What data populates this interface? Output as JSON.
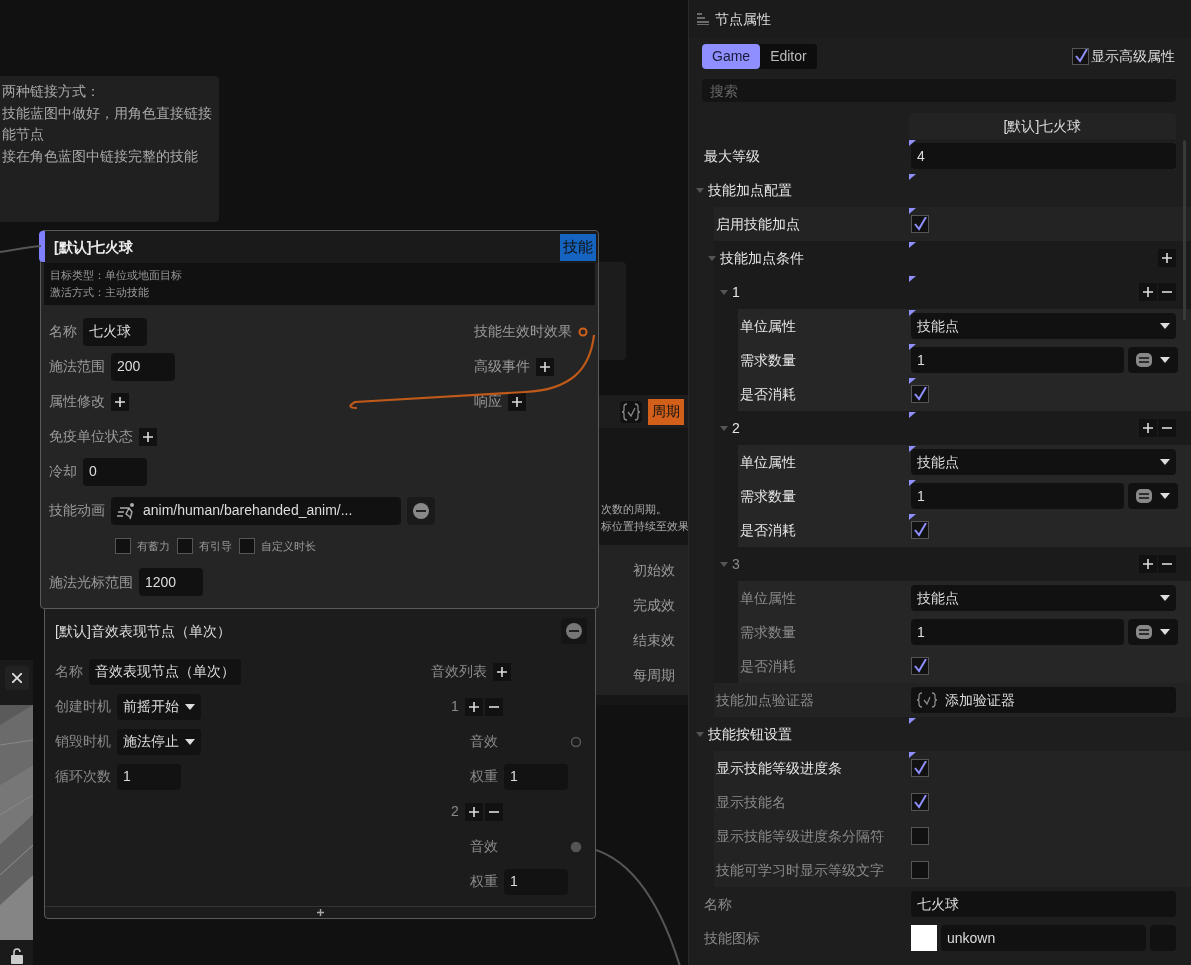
{
  "canvas": {
    "comment": {
      "lines": [
        "两种链接方式：",
        "技能蓝图中做好，用角色直接链接",
        "能节点",
        "接在角色蓝图中链接完整的技能"
      ]
    },
    "back_node": {
      "badge": "周期",
      "description": [
        "次数的周期。",
        "标位置持续至效果"
      ],
      "outputs": [
        "初始效",
        "完成效",
        "结束效",
        "每周期"
      ]
    },
    "skill_node": {
      "title": "[默认]七火球",
      "badge": "技能",
      "info": [
        "目标类型：单位或地面目标",
        "激活方式：主动技能"
      ],
      "rows": [
        {
          "kind": "field",
          "label": "名称",
          "value": "七火球"
        },
        {
          "kind": "field",
          "label": "施法范围",
          "value": "200"
        },
        {
          "kind": "add",
          "label": "属性修改"
        },
        {
          "kind": "add",
          "label": "免疫单位状态"
        },
        {
          "kind": "field",
          "label": "冷却",
          "value": "0"
        },
        {
          "kind": "asset",
          "label": "技能动画",
          "value": "anim/human/barehanded_anim/..."
        },
        {
          "kind": "flags",
          "items": [
            {
              "label": "有蓄力",
              "checked": false
            },
            {
              "label": "有引导",
              "checked": false
            },
            {
              "label": "自定义时长",
              "checked": false
            }
          ]
        },
        {
          "kind": "field",
          "label": "施法光标范围",
          "value": "1200"
        }
      ],
      "outputs": [
        {
          "kind": "port",
          "label": "技能生效时效果"
        },
        {
          "kind": "add",
          "label": "高级事件"
        },
        {
          "kind": "add",
          "label": "响应"
        }
      ]
    },
    "sound_node": {
      "title": "[默认]音效表现节点（单次）",
      "rows": [
        {
          "kind": "field",
          "label": "名称",
          "value": "音效表现节点（单次）"
        },
        {
          "kind": "dropdown",
          "label": "创建时机",
          "value": "前摇开始"
        },
        {
          "kind": "dropdown",
          "label": "销毁时机",
          "value": "施法停止"
        },
        {
          "kind": "field",
          "label": "循环次数",
          "value": "1"
        }
      ],
      "list_label": "音效列表",
      "entries": [
        {
          "index": "1",
          "port_label": "音效",
          "connected": false,
          "weight_label": "权重",
          "weight": "1"
        },
        {
          "index": "2",
          "port_label": "音效",
          "connected": true,
          "weight_label": "权重",
          "weight": "1"
        }
      ]
    }
  },
  "panel": {
    "title": "节点属性",
    "tabs": [
      {
        "label": "Game",
        "selected": true
      },
      {
        "label": "Editor",
        "selected": false
      }
    ],
    "advanced": {
      "label": "显示高级属性",
      "checked": true
    },
    "search": {
      "placeholder": "搜索"
    },
    "column_header": "[默认]七火球",
    "properties": [
      {
        "kind": "text",
        "label": "最大等级",
        "value": "4",
        "modified": true
      },
      {
        "kind": "group",
        "label": "技能加点配置",
        "expanded": true,
        "modified": true,
        "children": [
          {
            "kind": "checkbox",
            "label": "启用技能加点",
            "checked": true,
            "modified": true
          },
          {
            "kind": "group",
            "label": "技能加点条件",
            "expanded": true,
            "modified": true,
            "can_add": true,
            "children": [
              {
                "kind": "group",
                "label": "1",
                "expanded": true,
                "modified": true,
                "can_add": true,
                "can_remove": true,
                "children": [
                  {
                    "kind": "dropdown",
                    "label": "单位属性",
                    "value": "技能点",
                    "modified": true
                  },
                  {
                    "kind": "compare",
                    "label": "需求数量",
                    "value": "1",
                    "modified": true
                  },
                  {
                    "kind": "checkbox",
                    "label": "是否消耗",
                    "checked": true,
                    "modified": true
                  }
                ]
              },
              {
                "kind": "group",
                "label": "2",
                "expanded": true,
                "modified": true,
                "can_add": true,
                "can_remove": true,
                "children": [
                  {
                    "kind": "dropdown",
                    "label": "单位属性",
                    "value": "技能点",
                    "modified": true
                  },
                  {
                    "kind": "compare",
                    "label": "需求数量",
                    "value": "1",
                    "modified": true
                  },
                  {
                    "kind": "checkbox",
                    "label": "是否消耗",
                    "checked": true,
                    "modified": true
                  }
                ]
              },
              {
                "kind": "group",
                "label": "3",
                "expanded": true,
                "modified": false,
                "can_add": true,
                "can_remove": true,
                "children": [
                  {
                    "kind": "dropdown",
                    "label": "单位属性",
                    "value": "技能点",
                    "modified": false
                  },
                  {
                    "kind": "compare",
                    "label": "需求数量",
                    "value": "1",
                    "modified": false
                  },
                  {
                    "kind": "checkbox",
                    "label": "是否消耗",
                    "checked": true,
                    "modified": false
                  }
                ]
              }
            ]
          },
          {
            "kind": "validator",
            "label": "技能加点验证器",
            "value": "添加验证器",
            "modified": false
          }
        ]
      },
      {
        "kind": "group",
        "label": "技能按钮设置",
        "expanded": true,
        "modified": true,
        "children": [
          {
            "kind": "checkbox",
            "label": "显示技能等级进度条",
            "checked": true,
            "modified": true
          },
          {
            "kind": "checkbox",
            "label": "显示技能名",
            "checked": true,
            "modified": false
          },
          {
            "kind": "checkbox",
            "label": "显示技能等级进度条分隔符",
            "checked": false,
            "modified": false
          },
          {
            "kind": "checkbox",
            "label": "技能可学习时显示等级文字",
            "checked": false,
            "modified": false
          }
        ]
      },
      {
        "kind": "text",
        "label": "名称",
        "value": "七火球",
        "modified": false
      },
      {
        "kind": "icon",
        "label": "技能图标",
        "value": "unkown",
        "modified": false
      }
    ]
  }
}
